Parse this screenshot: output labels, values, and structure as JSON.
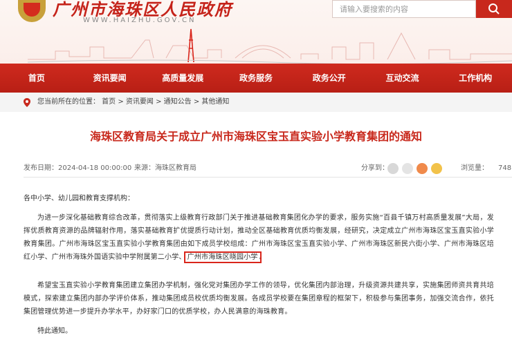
{
  "header": {
    "site_title": "广州市海珠区人民政府",
    "site_url": "WWW.HAIZHU.GOV.CN",
    "search_placeholder": "请输入要搜索的内容"
  },
  "nav": {
    "items": [
      "首页",
      "资讯要闻",
      "高质量发展",
      "政务服务",
      "政务公开",
      "互动交流",
      "工作机构"
    ]
  },
  "breadcrumb": {
    "text": "您当前所在的位置：  首页  >  资讯要闻  >  通知公告  >  其他通知"
  },
  "article": {
    "title": "海珠区教育局关于成立广州市海珠区宝玉直实验小学教育集团的通知",
    "date": "发布日期：2024-04-18 00:00:00",
    "source": "来源：海珠区教育局",
    "share_label": "分享到：",
    "views_label": "浏览量：",
    "views_count": "748",
    "salutation": "各中小学、幼儿园和教育支撑机构：",
    "para1_a": "为进一步深化基础教育综合改革，贯彻落实上级教育行政部门关于推进基础教育集团化办学的要求，服务实施“百县千镇万村高质量发展”大局，发挥优质教育资源的品牌辐射作用，落实基础教育扩优提质行动计划，推动全区基础教育优质均衡发展，经研究，决定成立广州市海珠区宝玉直实验小学教育集团。广州市海珠区宝玉直实验小学教育集团由如下成员学校组成：广州市海珠区宝玉直实验小学、广州市海珠区新民六街小学、广州市海珠区培红小学、广州市海珠外国语实验中学附属第二小学、",
    "para1_highlight": "广州市海珠区晓园小学",
    "para1_end": "。",
    "para2": "希望宝玉直实验小学教育集团建立集团办学机制，强化党对集团办学工作的领导，优化集团内部治理，升级资源共建共享，实施集团师资共育共培模式，探索建立集团内部办学评价体系，推动集团成员校优质均衡发展。各成员学校要在集团章程的框架下，积极参与集团事务，加强交流合作，依托集团管理优势进一步提升办学水平，办好家门口的优质学校，办人民满意的海珠教育。",
    "closing": "特此通知。"
  },
  "colors": {
    "brand_red": "#c8281c",
    "highlight_border": "#d9251b"
  }
}
